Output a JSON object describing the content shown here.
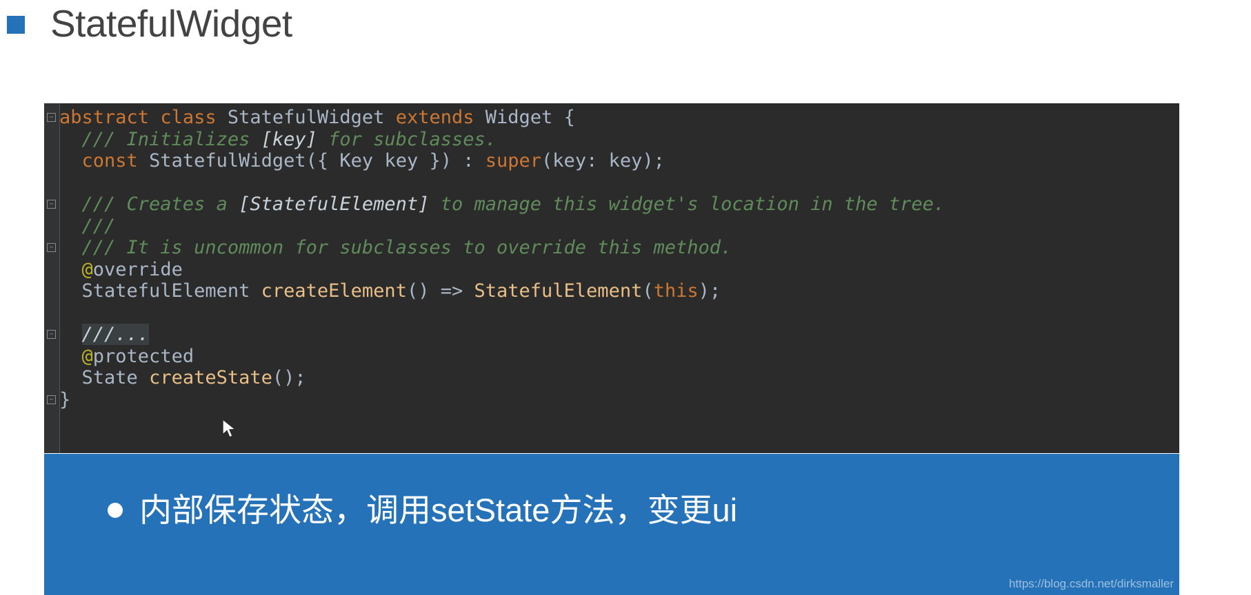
{
  "slide": {
    "title": "StatefulWidget",
    "title_bullet_color": "#2572b8"
  },
  "code": {
    "language": "dart",
    "background_color": "#2b2b2b",
    "lines": [
      {
        "tokens": [
          {
            "t": "abstract",
            "c": "kw"
          },
          {
            "t": " ",
            "c": "punc"
          },
          {
            "t": "class",
            "c": "kw"
          },
          {
            "t": " ",
            "c": "punc"
          },
          {
            "t": "StatefulWidget",
            "c": "typ"
          },
          {
            "t": " ",
            "c": "punc"
          },
          {
            "t": "extends",
            "c": "kw"
          },
          {
            "t": " ",
            "c": "punc"
          },
          {
            "t": "Widget",
            "c": "typ"
          },
          {
            "t": " {",
            "c": "punc"
          }
        ]
      },
      {
        "tokens": [
          {
            "t": "  /// Initializes ",
            "c": "cmt"
          },
          {
            "t": "[key]",
            "c": "cmtref"
          },
          {
            "t": " for subclasses.",
            "c": "cmt"
          }
        ]
      },
      {
        "tokens": [
          {
            "t": "  ",
            "c": "punc"
          },
          {
            "t": "const",
            "c": "kw"
          },
          {
            "t": " ",
            "c": "punc"
          },
          {
            "t": "StatefulWidget",
            "c": "typ"
          },
          {
            "t": "({ ",
            "c": "punc"
          },
          {
            "t": "Key",
            "c": "typ"
          },
          {
            "t": " key }) : ",
            "c": "punc"
          },
          {
            "t": "super",
            "c": "kw"
          },
          {
            "t": "(key: key);",
            "c": "punc"
          }
        ]
      },
      {
        "tokens": []
      },
      {
        "tokens": [
          {
            "t": "  /// Creates a ",
            "c": "cmt"
          },
          {
            "t": "[StatefulElement]",
            "c": "cmtref"
          },
          {
            "t": " to manage this widget's location in the tree.",
            "c": "cmt"
          }
        ]
      },
      {
        "tokens": [
          {
            "t": "  ///",
            "c": "cmt"
          }
        ]
      },
      {
        "tokens": [
          {
            "t": "  /// It is uncommon for subclasses to override this method.",
            "c": "cmt"
          }
        ]
      },
      {
        "tokens": [
          {
            "t": "  @",
            "c": "ann"
          },
          {
            "t": "override",
            "c": "anntxt"
          }
        ]
      },
      {
        "tokens": [
          {
            "t": "  ",
            "c": "punc"
          },
          {
            "t": "StatefulElement",
            "c": "typ"
          },
          {
            "t": " ",
            "c": "punc"
          },
          {
            "t": "createElement",
            "c": "fn"
          },
          {
            "t": "() => ",
            "c": "punc"
          },
          {
            "t": "StatefulElement",
            "c": "fn"
          },
          {
            "t": "(",
            "c": "punc"
          },
          {
            "t": "this",
            "c": "kw"
          },
          {
            "t": ");",
            "c": "punc"
          }
        ]
      },
      {
        "tokens": []
      },
      {
        "tokens": [
          {
            "t": "  ",
            "c": "punc"
          },
          {
            "t": "///...",
            "c": "cmtref hl"
          }
        ]
      },
      {
        "tokens": [
          {
            "t": "  @",
            "c": "ann"
          },
          {
            "t": "protected",
            "c": "anntxt"
          }
        ]
      },
      {
        "tokens": [
          {
            "t": "  ",
            "c": "punc"
          },
          {
            "t": "State",
            "c": "typ"
          },
          {
            "t": " ",
            "c": "punc"
          },
          {
            "t": "createState",
            "c": "fn"
          },
          {
            "t": "();",
            "c": "punc"
          }
        ]
      },
      {
        "tokens": [
          {
            "t": "}",
            "c": "punc"
          }
        ]
      }
    ],
    "fold_markers": [
      {
        "line": 0,
        "glyph": "−"
      },
      {
        "line": 4,
        "glyph": "−"
      },
      {
        "line": 6,
        "glyph": "−"
      },
      {
        "line": 10,
        "glyph": "−"
      },
      {
        "line": 13,
        "glyph": "−"
      }
    ]
  },
  "banner": {
    "background_color": "#2572b8",
    "bullet_color": "#ffffff",
    "text": "内部保存状态，调用setState方法，变更ui"
  },
  "watermark": {
    "text": "https://blog.csdn.net/dirksmaller"
  }
}
